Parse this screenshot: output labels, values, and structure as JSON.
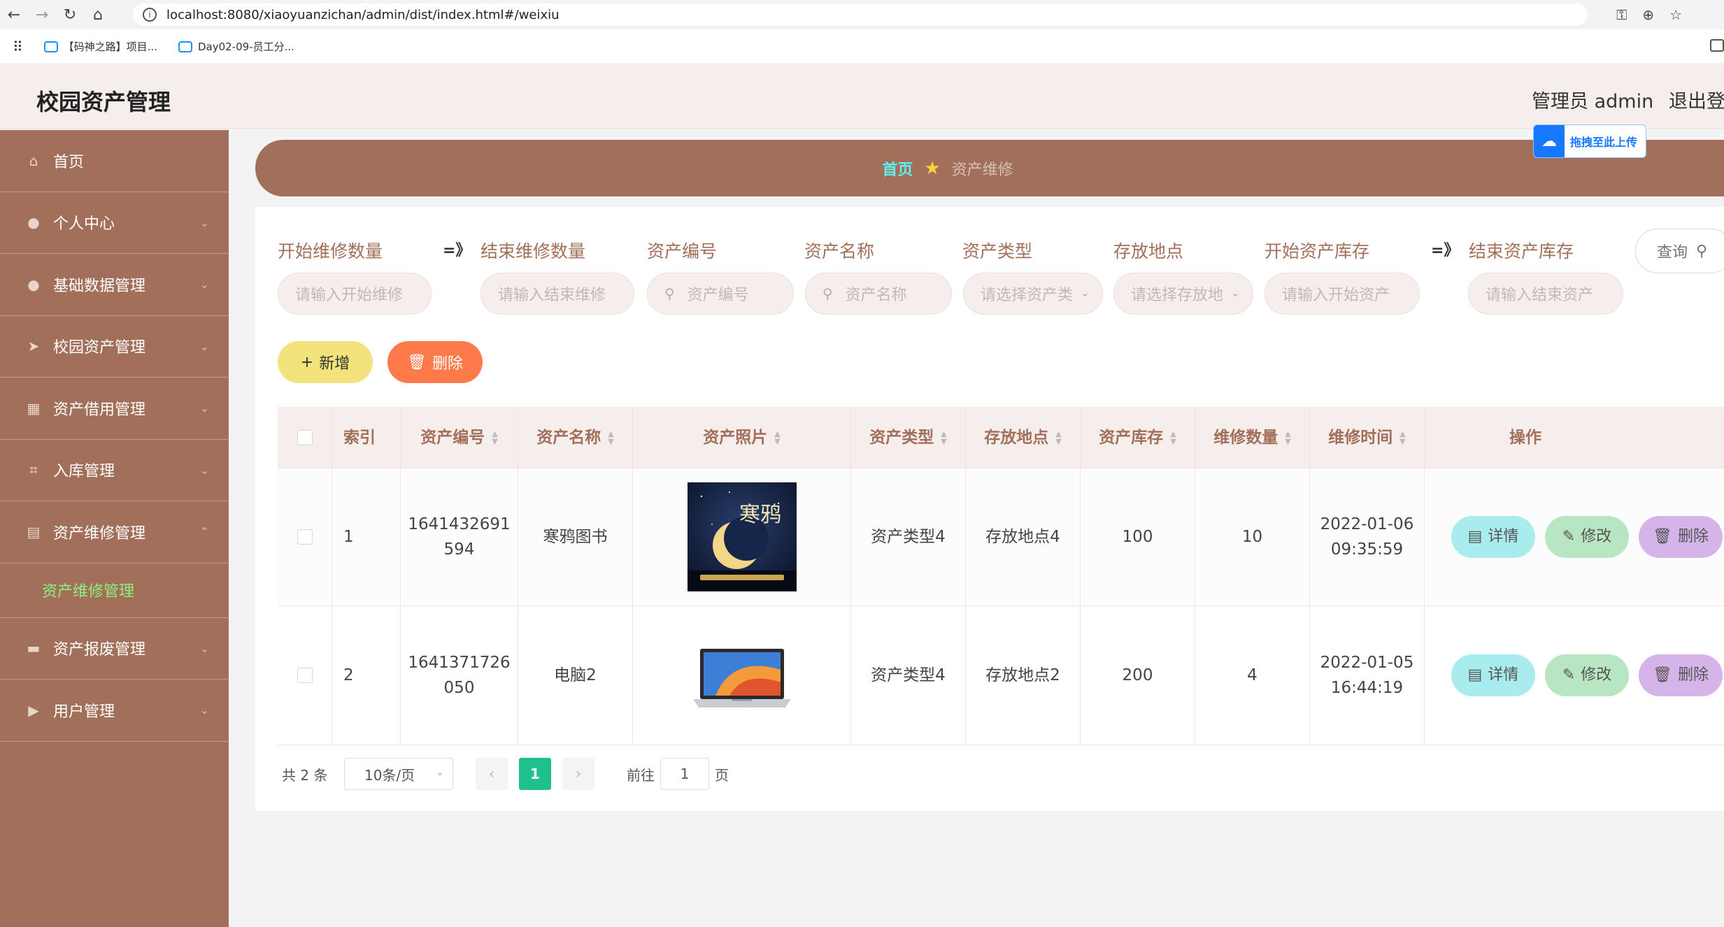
{
  "browser": {
    "url": "localhost:8080/xiaoyuanzichan/admin/dist/index.html#/weixiu",
    "bookmarks": [
      "【码神之路】项目...",
      "Day02-09-员工分..."
    ]
  },
  "header": {
    "title": "校园资产管理",
    "user": "管理员 admin",
    "logout": "退出登录"
  },
  "sidebar": {
    "items": [
      {
        "label": "首页",
        "icon": "home-icon"
      },
      {
        "label": "个人中心",
        "icon": "user-icon"
      },
      {
        "label": "基础数据管理",
        "icon": "user-icon"
      },
      {
        "label": "校园资产管理",
        "icon": "paper-plane-icon"
      },
      {
        "label": "资产借用管理",
        "icon": "grid-icon"
      },
      {
        "label": "入库管理",
        "icon": "crop-icon"
      },
      {
        "label": "资产维修管理",
        "icon": "chart-icon"
      }
    ],
    "sub_item": "资产维修管理",
    "items_after": [
      {
        "label": "资产报废管理",
        "icon": "briefcase-icon"
      },
      {
        "label": "用户管理",
        "icon": "video-icon"
      }
    ]
  },
  "breadcrumb": {
    "home": "首页",
    "current": "资产维修"
  },
  "upload_badge": "拖拽至此上传",
  "filters": {
    "start_repair_qty": {
      "label": "开始维修数量",
      "placeholder": "请输入开始维修"
    },
    "end_repair_qty": {
      "label": "结束维修数量",
      "placeholder": "请输入结束维修"
    },
    "asset_code": {
      "label": "资产编号",
      "placeholder": "资产编号"
    },
    "asset_name": {
      "label": "资产名称",
      "placeholder": "资产名称"
    },
    "asset_type": {
      "label": "资产类型",
      "placeholder": "请选择资产类"
    },
    "location": {
      "label": "存放地点",
      "placeholder": "请选择存放地"
    },
    "start_stock": {
      "label": "开始资产库存",
      "placeholder": "请输入开始资产"
    },
    "end_stock": {
      "label": "结束资产库存",
      "placeholder": "请输入结束资产"
    },
    "range_arrow": "=》",
    "query": "查询"
  },
  "actions": {
    "add": "新增",
    "delete": "删除"
  },
  "table": {
    "columns": [
      "索引",
      "资产编号",
      "资产名称",
      "资产照片",
      "资产类型",
      "存放地点",
      "资产库存",
      "维修数量",
      "维修时间",
      "操作"
    ],
    "rows": [
      {
        "index": "1",
        "code_a": "1641432691",
        "code_b": "594",
        "name": "寒鸦图书",
        "type": "资产类型4",
        "location": "存放地点4",
        "stock": "100",
        "repair_qty": "10",
        "date": "2022-01-06",
        "time": "09:35:59"
      },
      {
        "index": "2",
        "code_a": "1641371726",
        "code_b": "050",
        "name": "电脑2",
        "type": "资产类型4",
        "location": "存放地点2",
        "stock": "200",
        "repair_qty": "4",
        "date": "2022-01-05",
        "time": "16:44:19"
      }
    ],
    "row_actions": {
      "detail": "详情",
      "edit": "修改",
      "delete": "删除"
    },
    "book_cover_text": "寒鸦"
  },
  "pagination": {
    "total": "共 2 条",
    "page_size": "10条/页",
    "current": "1",
    "goto_label": "前往",
    "goto_value": "1",
    "page_suffix": "页"
  }
}
